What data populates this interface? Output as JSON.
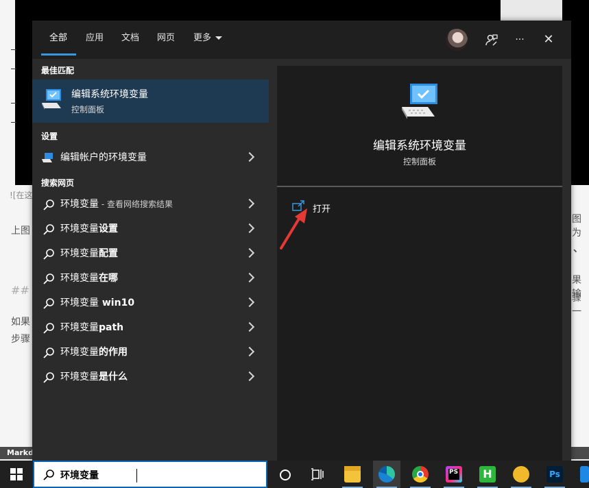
{
  "background": {
    "fragments": [
      "![在这",
      "上图",
      "## ",
      "如果",
      "步骤",
      "图为",
      "、",
      "果输",
      "骤一"
    ],
    "statusbar": "Markdo"
  },
  "tabs": [
    {
      "label": "全部",
      "active": true
    },
    {
      "label": "应用"
    },
    {
      "label": "文档"
    },
    {
      "label": "网页"
    },
    {
      "label": "更多"
    }
  ],
  "toolbar": {
    "feedback_icon": "feedback-person-icon",
    "more": "···",
    "close": "✕"
  },
  "left": {
    "best_match_heading": "最佳匹配",
    "best_match": {
      "title": "编辑系统环境变量",
      "subtitle": "控制面板",
      "icon": "computer-monitor-icon"
    },
    "settings_heading": "设置",
    "settings_item": "编辑帐户的环境变量",
    "web_heading": "搜索网页",
    "web_items": [
      {
        "prefix": "环境变量",
        "bold": "",
        "suffix": " - 查看网络搜索结果"
      },
      {
        "prefix": "环境变量",
        "bold": "设置",
        "suffix": ""
      },
      {
        "prefix": "环境变量",
        "bold": "配置",
        "suffix": ""
      },
      {
        "prefix": "环境变量",
        "bold": "在哪",
        "suffix": ""
      },
      {
        "prefix": "环境变量",
        "bold": " win10",
        "suffix": ""
      },
      {
        "prefix": "环境变量",
        "bold": "path",
        "suffix": ""
      },
      {
        "prefix": "环境变量",
        "bold": "的作用",
        "suffix": ""
      },
      {
        "prefix": "环境变量",
        "bold": "是什么",
        "suffix": ""
      }
    ]
  },
  "right": {
    "title": "编辑系统环境变量",
    "subtitle": "控制面板",
    "open_label": "打开"
  },
  "taskbar": {
    "search_query": "环境变量",
    "apps": [
      "task-view-icon",
      "file-explorer-icon",
      "edge-icon",
      "chrome-icon",
      "phpstorm-icon",
      "hbuilder-icon",
      "app-yellow-icon",
      "photoshop-icon",
      "calendar-icon"
    ],
    "colors": {
      "accent": "#0a64b4",
      "selected": "#1e3a52"
    }
  }
}
